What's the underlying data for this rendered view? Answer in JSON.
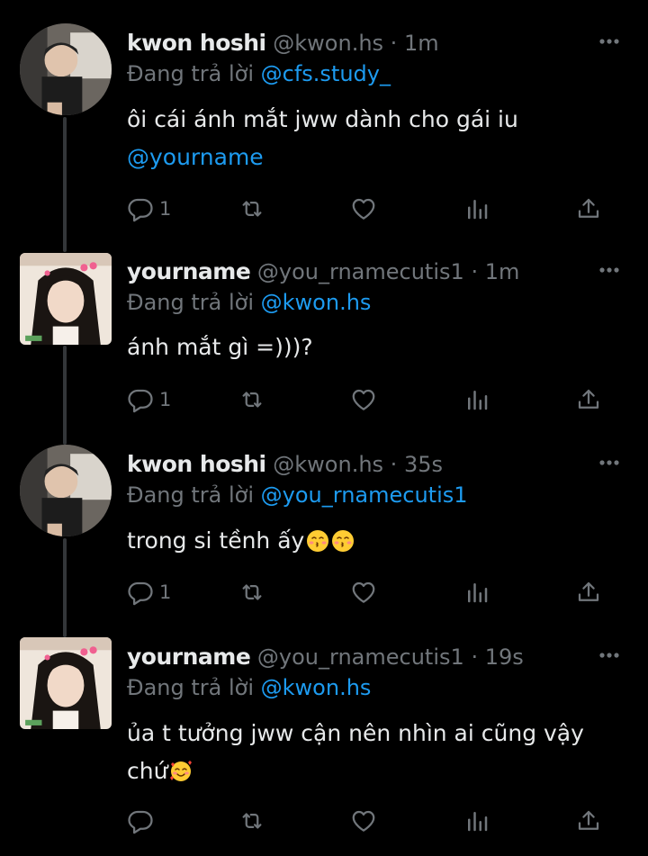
{
  "tweets": [
    {
      "name": "kwon hoshi",
      "handle": "@kwon.hs",
      "time": "1m",
      "reply_prefix": "Đang trả lời",
      "reply_to": "@cfs.study_",
      "text": "ôi cái ánh mắt jww dành cho gái iu",
      "text_mention": "@yourname",
      "reply_count": "1",
      "avatar": "male-avatar"
    },
    {
      "name": "yourname",
      "handle": "@you_rnamecutis1",
      "time": "1m",
      "reply_prefix": "Đang trả lời",
      "reply_to": "@kwon.hs",
      "text": "ánh mắt gì =)))?",
      "reply_count": "1",
      "avatar": "female-avatar"
    },
    {
      "name": "kwon hoshi",
      "handle": "@kwon.hs",
      "time": "35s",
      "reply_prefix": "Đang trả lời",
      "reply_to": "@you_rnamecutis1",
      "text": "trong si tềnh ấy",
      "reply_count": "1",
      "avatar": "male-avatar",
      "emoji": [
        "kissing-face-emoji",
        "kissing-face-emoji"
      ]
    },
    {
      "name": "yourname",
      "handle": "@you_rnamecutis1",
      "time": "19s",
      "reply_prefix": "Đang trả lời",
      "reply_to": "@kwon.hs",
      "text": "ủa t tưởng jww cận nên nhìn ai cũng vậy",
      "text_line2": "chứ",
      "reply_count": "",
      "avatar": "female-avatar",
      "emoji": [
        "smiling-face-with-hearts-emoji"
      ]
    }
  ],
  "separator": "·",
  "colors": {
    "background": "#000000",
    "text": "#e7e9ea",
    "muted": "#71767b",
    "link": "#1d9bf0",
    "thread_line": "#333639"
  }
}
